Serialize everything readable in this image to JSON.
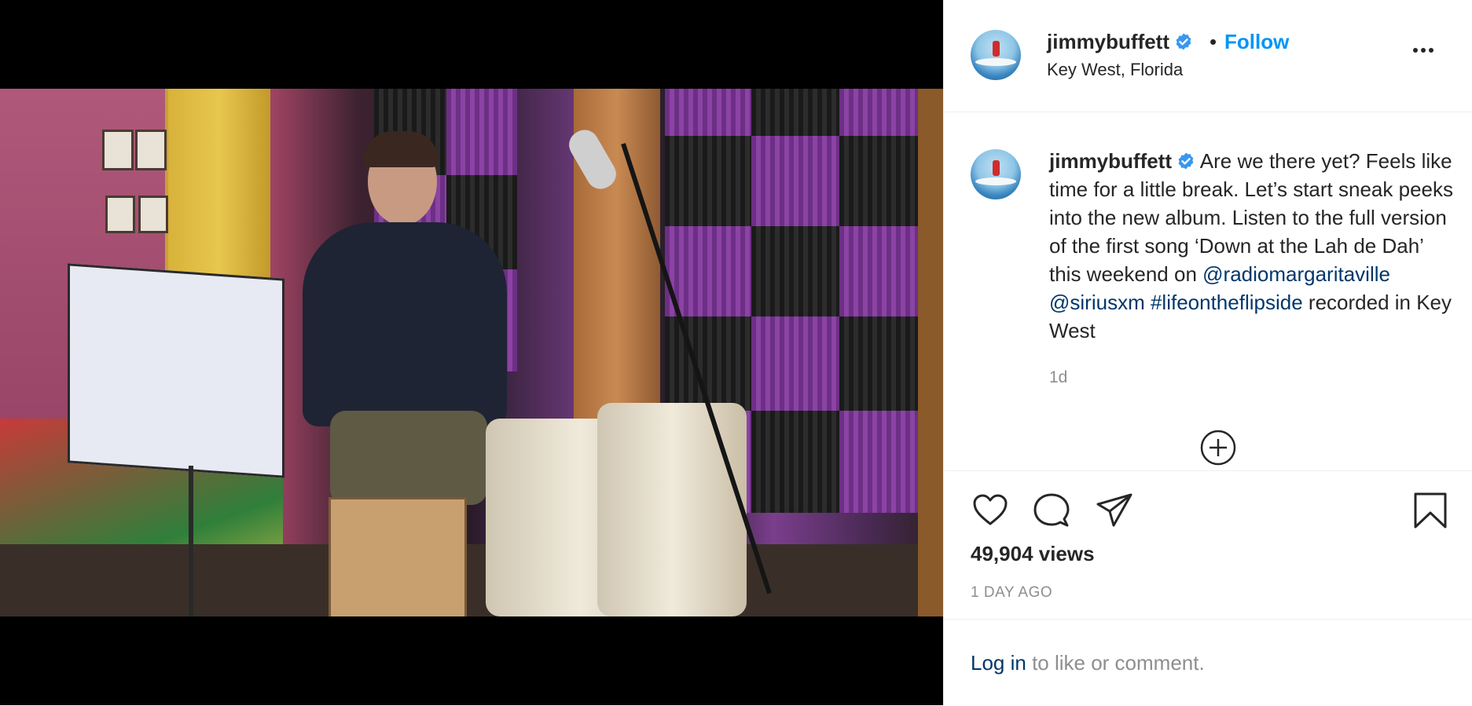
{
  "post": {
    "username": "jimmybuffett",
    "follow_label": "Follow",
    "separator": "•",
    "location": "Key West, Florida",
    "more_icon": "more-horizontal-icon",
    "verified_icon": "verified-badge-icon"
  },
  "caption": {
    "username": "jimmybuffett",
    "text": "Are we there yet? Feels like time for a little break. Let’s start sneak peeks into the new album. Listen to the full version of the first song ‘Down at the Lah de Dah’ this weekend on",
    "mention_1": "@radiomargaritaville",
    "mention_2": "@siriusxm",
    "hashtag": "#lifeontheflipside",
    "tail": "recorded in Key West",
    "time": "1d"
  },
  "actions": {
    "like_icon": "heart-icon",
    "comment_icon": "comment-icon",
    "share_icon": "paper-plane-icon",
    "save_icon": "bookmark-icon",
    "load_more_icon": "plus-circle-icon",
    "views": "49,904 views",
    "posted_ago": "1 DAY AGO"
  },
  "login": {
    "link": "Log in",
    "rest": " to like or comment."
  },
  "colors": {
    "accent": "#0095f6",
    "link": "#00376b",
    "muted": "#8e8e8e",
    "text": "#262626"
  }
}
